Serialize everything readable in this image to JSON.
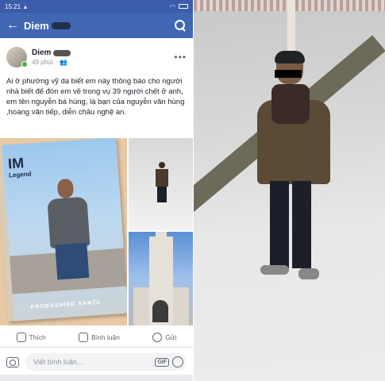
{
  "status": {
    "time": "15:21"
  },
  "nav": {
    "title": "Diem"
  },
  "post": {
    "author": "Diem",
    "time_ago": "49 phút",
    "text": "Ai ở phường vỹ dạ biết em này thông báo cho người nhà biết để đón em về trong vụ 39 người chết ở anh, em tên nguyễn bá hùng, là bạn của nguyễn văn hùng ,hoàng văn tiếp, diễn châu nghệ an."
  },
  "book": {
    "title": "IM",
    "subtitle": "Legend",
    "author_line": "PROBASHIRD SANTA"
  },
  "actions": {
    "like": "Thích",
    "comment": "Bình luận",
    "share": "Gửi"
  },
  "comment_bar": {
    "placeholder": "Viết bình luận...",
    "gif": "GIF"
  },
  "colors": {
    "brand": "#4267b2",
    "status": "#3b5bab"
  }
}
